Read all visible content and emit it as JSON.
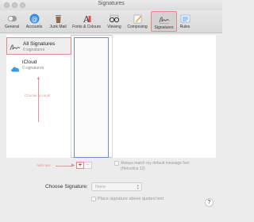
{
  "window": {
    "title": "Signatures"
  },
  "toolbar": {
    "items": [
      {
        "label": "General",
        "icon": "switch-icon"
      },
      {
        "label": "Accounts",
        "icon": "at-icon"
      },
      {
        "label": "Junk Mail",
        "icon": "trash-icon"
      },
      {
        "label": "Fonts & Colours",
        "icon": "font-icon"
      },
      {
        "label": "Viewing",
        "icon": "glasses-icon"
      },
      {
        "label": "Composing",
        "icon": "pencil-icon"
      },
      {
        "label": "Signatures",
        "icon": "signature-icon",
        "selected": true
      },
      {
        "label": "Rules",
        "icon": "rules-icon"
      }
    ]
  },
  "accounts": [
    {
      "name": "All Signatures",
      "count": "0 signatures",
      "icon": "signature-icon",
      "selected": true
    },
    {
      "name": "iCloud",
      "count": "0 signatures",
      "icon": "cloud-icon",
      "selected": false
    }
  ],
  "annotations": {
    "choose_account": "Choose account",
    "add_new": "Add new"
  },
  "options": {
    "match_font_label": "Always match my default message font",
    "match_font_detail": "(Helvetica 12)",
    "choose_signature_label": "Choose Signature:",
    "choose_signature_value": "None",
    "place_above_label": "Place signature above quoted text"
  },
  "buttons": {
    "add": "+",
    "remove": "−",
    "help": "?"
  },
  "colors": {
    "annotation": "#e3898e",
    "selection_focus": "#6a8ed8",
    "cloud": "#3a9be8"
  }
}
